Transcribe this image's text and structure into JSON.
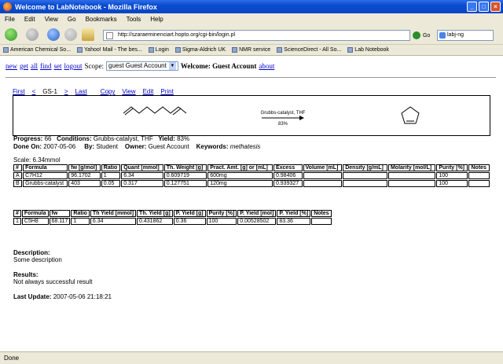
{
  "window": {
    "title": "Welcome to LabNotebook - Mozilla Firefox"
  },
  "menu": [
    "File",
    "Edit",
    "View",
    "Go",
    "Bookmarks",
    "Tools",
    "Help"
  ],
  "nav": {
    "url": "http://szaraeminenciart.hopto.org/cgi-bin/login.pl",
    "go_label": "Go",
    "search_value": "labj-ng"
  },
  "bookmarks": [
    "American Chemical So...",
    "Yahoo! Mail - The bes...",
    "Login",
    "Sigma-Aldrich UK",
    "NMR service",
    "ScienceDirect - All So...",
    "Lab Notebook"
  ],
  "top": {
    "new_link": "new",
    "get_link": "get",
    "all_link": "all",
    "find_link": "find",
    "set_link": "set",
    "logout_link": "logout",
    "scope_label": "Scope:",
    "scope_value": "guest Guest Account",
    "welcome": "Welcome: Guest Account",
    "about_link": "about"
  },
  "actions": {
    "first": "First",
    "prev": "<",
    "current": "GS-1",
    "next": ">",
    "last": "Last",
    "copy": "Copy",
    "view": "View",
    "edit": "Edit",
    "print": "Print"
  },
  "scheme": {
    "reagents": "Grubbs-catalyst, THF",
    "yield": "83%"
  },
  "info": {
    "progress_label": "Progress:",
    "progress_value": "66",
    "conditions_label": "Conditions:",
    "conditions_value": "Grubbs-catalyst, THF",
    "yield_label": "Yield:",
    "yield_value": "83%",
    "done_on_label": "Done On:",
    "done_on_value": "2007-05-06",
    "by_label": "By:",
    "by_value": "Student",
    "owner_label": "Owner:",
    "owner_value": "Guest Account",
    "keywords_label": "Keywords:",
    "keywords_value": "methatesis",
    "scale_label": "Scale:",
    "scale_value": "6.34mmol"
  },
  "reactants": {
    "headers": [
      "#",
      "Formula",
      "fw [g/mol]",
      "Ratio",
      "Quant [mmol]",
      "Th. Weight [g]",
      "Pract. Amt. [g] or [mL]",
      "Excess",
      "Volume [mL]",
      "Density [g/mL]",
      "Molarity [mol/L]",
      "Purity [%]",
      "Notes"
    ],
    "rows": [
      [
        "A",
        "C7H12",
        "96.1702",
        "1",
        "6.34",
        "0.609719",
        "600mg",
        "0.98406",
        "",
        "",
        "",
        "100",
        ""
      ],
      [
        "B",
        "Grubbs-catalyst",
        "403",
        "0.05",
        "0.317",
        "0.127751",
        "120mg",
        "0.939327",
        "",
        "",
        "",
        "100",
        ""
      ]
    ]
  },
  "products": {
    "headers": [
      "#",
      "Formula",
      "fw",
      "Ratio",
      "Th Yield [mmol]",
      "Th. Yield [g]",
      "P. Yield [g]",
      "Purity [%]",
      "P. Yield [mol]",
      "P. Yield [%]",
      "Notes"
    ],
    "rows": [
      [
        "1",
        "C5H8",
        "68.117",
        "1",
        "6.34",
        "0.431862",
        "0.36",
        "100",
        "0.00528502",
        "83.36",
        ""
      ]
    ]
  },
  "description": {
    "label": "Description:",
    "text": "Some description"
  },
  "results": {
    "label": "Results:",
    "text": "Not always successful result"
  },
  "last_update": {
    "label": "Last Update:",
    "value": "2007-05-06 21:18:21"
  },
  "status": "Done"
}
